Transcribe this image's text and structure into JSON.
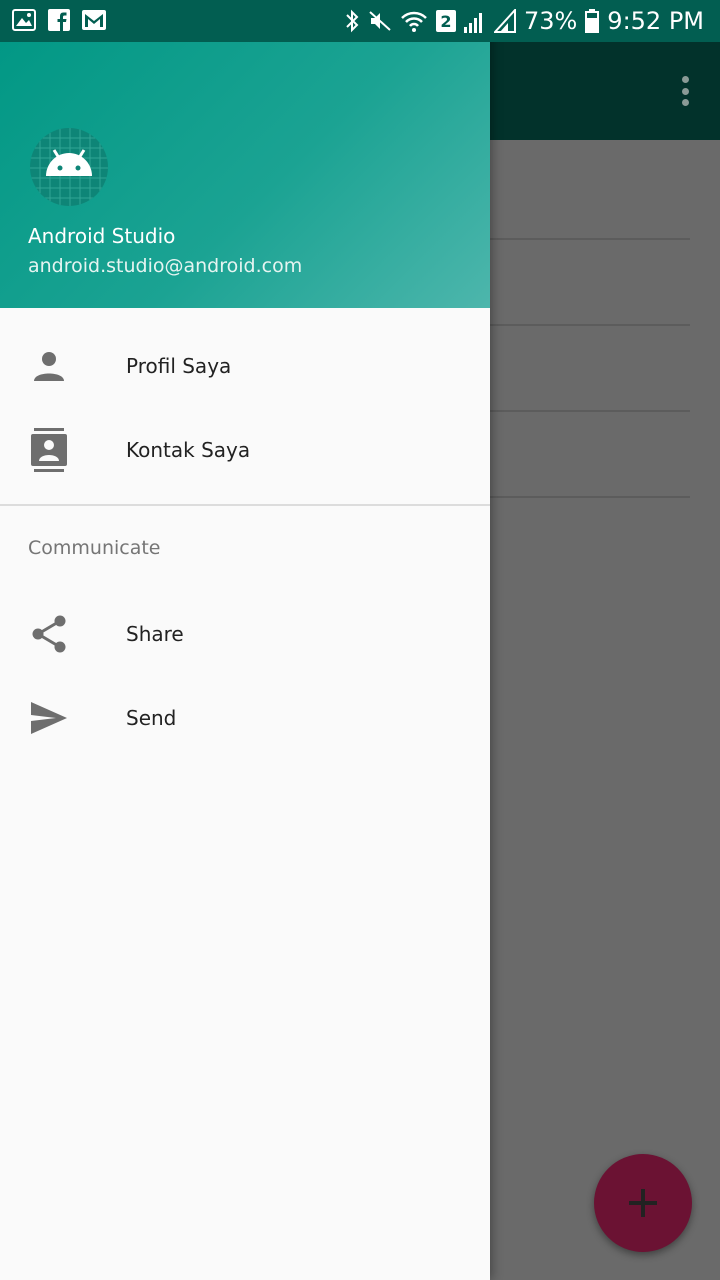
{
  "status_bar": {
    "signal_badge": "2",
    "battery": "73%",
    "time": "9:52 PM"
  },
  "drawer": {
    "header": {
      "name": "Android Studio",
      "email": "android.studio@android.com"
    },
    "items": [
      {
        "label": "Profil Saya",
        "icon": "person-icon"
      },
      {
        "label": "Kontak Saya",
        "icon": "contacts-icon"
      }
    ],
    "section": {
      "title": "Communicate",
      "items": [
        {
          "label": "Share",
          "icon": "share-icon"
        },
        {
          "label": "Send",
          "icon": "send-icon"
        }
      ]
    }
  },
  "colors": {
    "status_bar": "#025e51",
    "header_start": "#029885",
    "header_end": "#4db6ac",
    "fab": "#6b1233",
    "scrim": "#6a6a6a",
    "icon": "#6e6e6e"
  }
}
